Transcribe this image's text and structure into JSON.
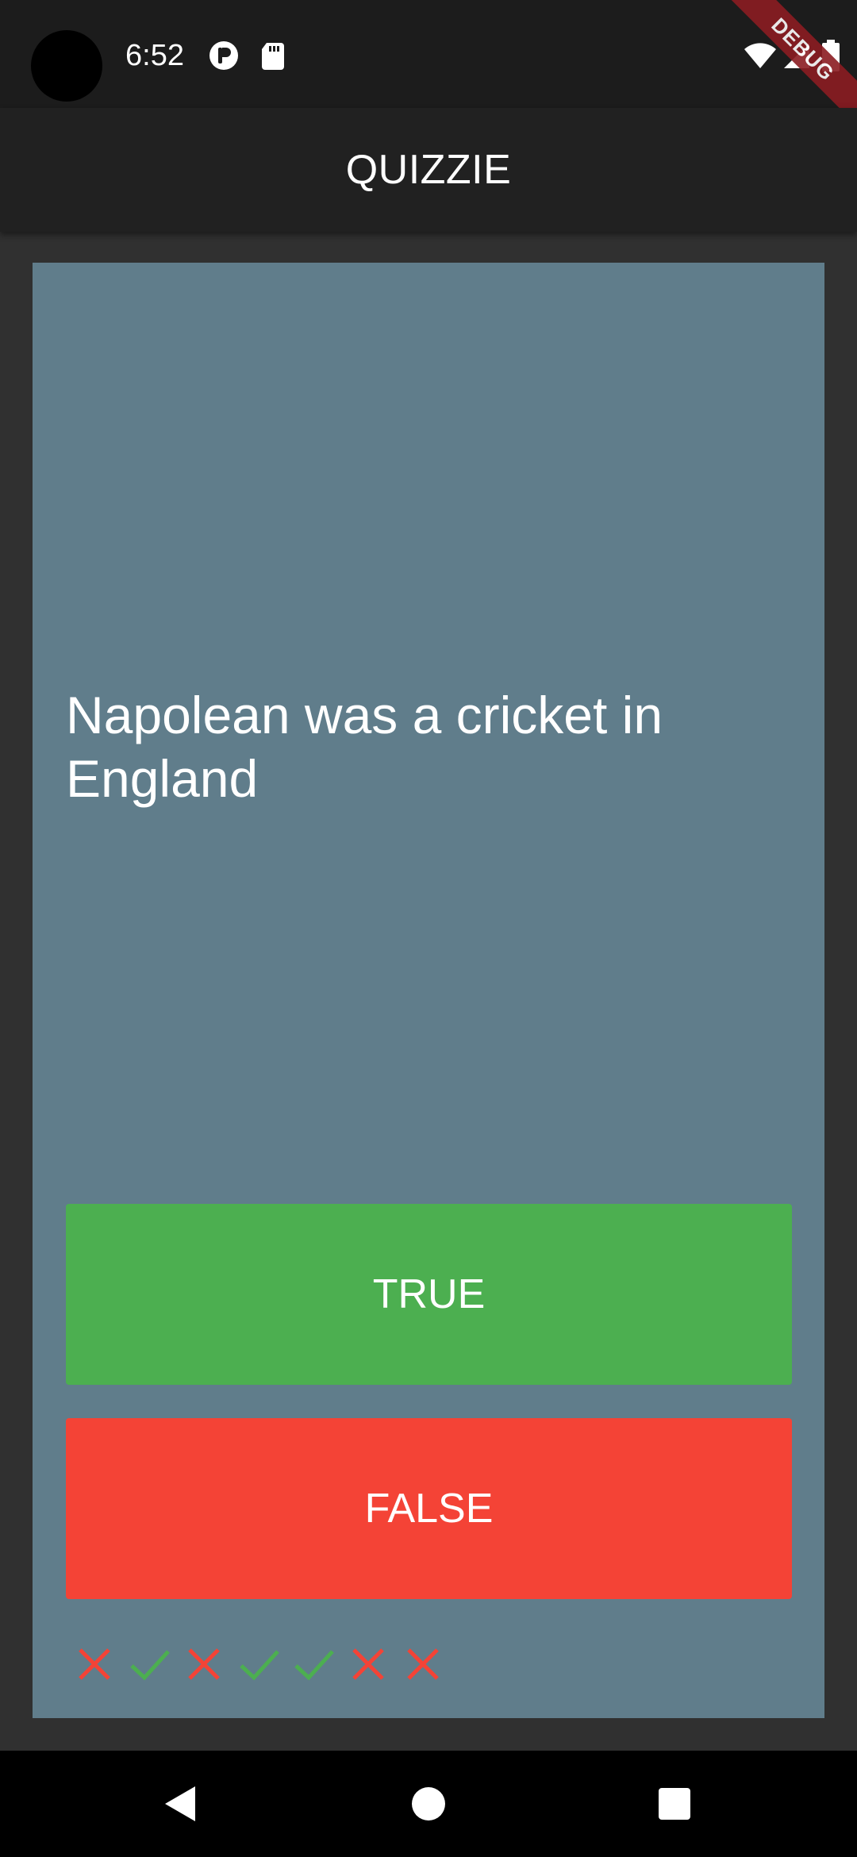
{
  "status_bar": {
    "time": "6:52",
    "debug_label": "DEBUG",
    "icons": [
      "camera-cutout",
      "notification-p-icon",
      "sd-card-icon",
      "wifi-icon",
      "signal-icon",
      "battery-icon"
    ]
  },
  "app_bar": {
    "title": "QUIZZIE"
  },
  "quiz": {
    "question": "Napolean was a cricket in England",
    "true_label": "TRUE",
    "false_label": "FALSE",
    "score_keeper": [
      "wrong",
      "correct",
      "wrong",
      "correct",
      "correct",
      "wrong",
      "wrong"
    ]
  },
  "colors": {
    "background": "#303030",
    "app_bar": "#212121",
    "card": "#607d8b",
    "true_button": "#4caf50",
    "false_button": "#f44336",
    "check": "#4caf50",
    "cross": "#f44336"
  },
  "nav_bar": {
    "buttons": [
      "back-icon",
      "home-icon",
      "recents-icon"
    ]
  }
}
